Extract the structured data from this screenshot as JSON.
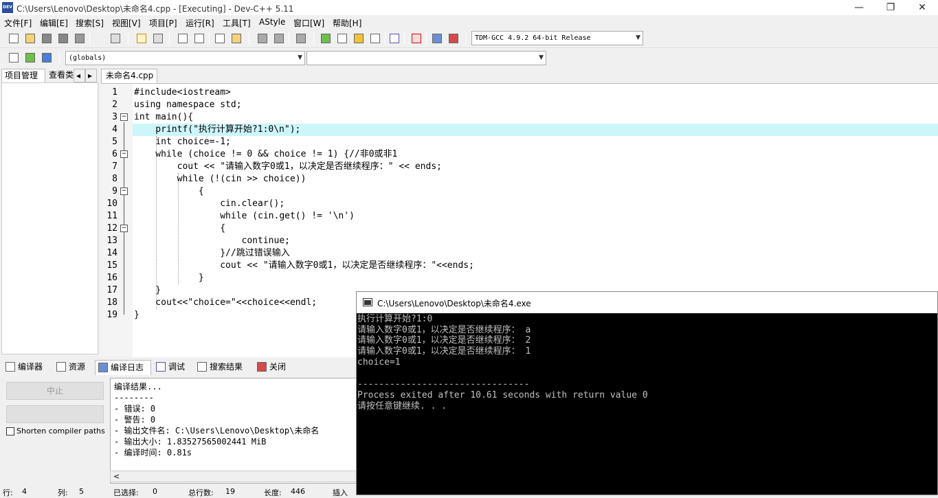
{
  "window": {
    "title": "C:\\Users\\Lenovo\\Desktop\\未命名4.cpp - [Executing] - Dev-C++ 5.11",
    "icon_text": "DEV",
    "minimize": "—",
    "restore": "❐",
    "close": "✕"
  },
  "menu": [
    "文件[F]",
    "编辑[E]",
    "搜索[S]",
    "视图[V]",
    "项目[P]",
    "运行[R]",
    "工具[T]",
    "AStyle",
    "窗口[W]",
    "帮助[H]"
  ],
  "toolbar": {
    "compiler_select": "TDM-GCC 4.9.2 64-bit Release",
    "globals_select": "(globals)",
    "members_select": ""
  },
  "left_panel": {
    "tabs": [
      "项目管理",
      "查看类"
    ],
    "scroll_left": "◂",
    "scroll_right": "▸"
  },
  "editor": {
    "tab_label": "未命名4.cpp",
    "line_numbers": [
      "1",
      "2",
      "3",
      "4",
      "5",
      "6",
      "7",
      "8",
      "9",
      "10",
      "11",
      "12",
      "13",
      "14",
      "15",
      "16",
      "17",
      "18",
      "19"
    ],
    "lines": [
      "#include<iostream>",
      "using namespace std;",
      "int main(){",
      "    printf(\"执行计算开始?1:0\\n\");",
      "    int choice=-1;",
      "    while (choice != 0 && choice != 1) {//非0或非1",
      "        cout << \"请输入数字0或1，以决定是否继续程序：\" << ends;",
      "        while (!(cin >> choice))",
      "            {",
      "                cin.clear();",
      "                while (cin.get() != '\\n')",
      "                {",
      "                    continue;",
      "                }//跳过错误输入",
      "                cout << \"请输入数字0或1，以决定是否继续程序：\"<<ends;",
      "            }",
      "    }",
      "    cout<<\"choice=\"<<choice<<endl;",
      "}"
    ],
    "current_line": 4
  },
  "bottom_panel": {
    "tabs": [
      "编译器",
      "资源",
      "编译日志",
      "调试",
      "搜索结果",
      "关闭"
    ],
    "active_tab": "编译日志",
    "abort_button": "中止",
    "shorten_checkbox": "Shorten compiler paths",
    "log": [
      "编译结果...",
      "--------",
      "- 错误: 0",
      "- 警告: 0",
      "- 输出文件名: C:\\Users\\Lenovo\\Desktop\\未命名",
      "- 输出大小: 1.83527565002441 MiB",
      "- 编译时间: 0.81s"
    ],
    "scroll_left": "<"
  },
  "status_bar": {
    "row_label": "行:",
    "row_value": "4",
    "col_label": "列:",
    "col_value": "5",
    "sel_label": "已选择:",
    "sel_value": "0",
    "total_label": "总行数:",
    "total_value": "19",
    "len_label": "长度:",
    "len_value": "446",
    "mode": "插入"
  },
  "console": {
    "title": "C:\\Users\\Lenovo\\Desktop\\未命名4.exe",
    "lines": [
      "执行计算开始?1:0",
      "请输入数字0或1，以决定是否继续程序： a",
      "请输入数字0或1，以决定是否继续程序： 2",
      "请输入数字0或1，以决定是否继续程序： 1",
      "choice=1",
      "",
      "--------------------------------",
      "Process exited after 10.61 seconds with return value 0",
      "请按任意键继续. . ."
    ]
  },
  "colors": {
    "current_line": "#cdf6fb",
    "keyword": "#000000",
    "string": "#0000e6",
    "number": "#800080",
    "operator": "#e00000",
    "comment": "#0080ff",
    "preprocessor": "#0b8a0b"
  }
}
